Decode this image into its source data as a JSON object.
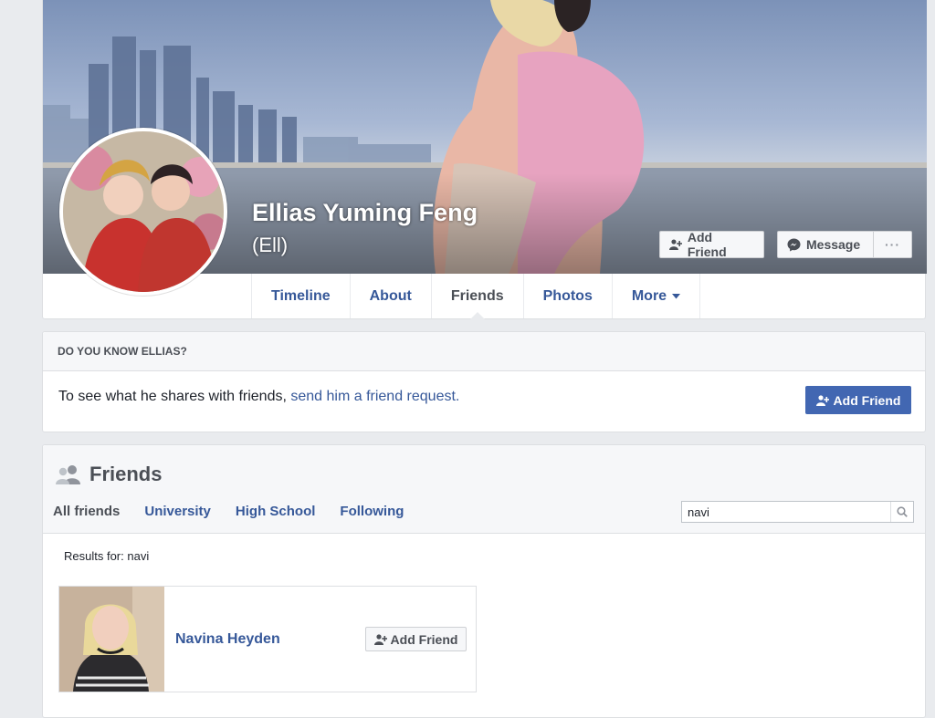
{
  "profile": {
    "name": "Ellias Yuming Feng",
    "alternate_name": "(Ell)",
    "add_friend_label": "Add Friend",
    "message_label": "Message",
    "more_dots": "···"
  },
  "tabs": [
    {
      "label": "Timeline"
    },
    {
      "label": "About"
    },
    {
      "label": "Friends",
      "active": true
    },
    {
      "label": "Photos"
    },
    {
      "label": "More"
    }
  ],
  "know_card": {
    "heading": "DO YOU KNOW ELLIAS?",
    "text": "To see what he shares with friends,",
    "link": "send him a friend request.",
    "button": "Add Friend"
  },
  "friends": {
    "title": "Friends",
    "subtabs": [
      {
        "label": "All friends",
        "active": true
      },
      {
        "label": "University"
      },
      {
        "label": "High School"
      },
      {
        "label": "Following"
      }
    ],
    "search_value": "navi",
    "results_label": "Results for: navi",
    "results": [
      {
        "name": "Navina Heyden",
        "button": "Add Friend"
      }
    ]
  },
  "colors": {
    "link_blue": "#365899",
    "button_blue": "#4267b2",
    "page_bg": "#e9ebee",
    "muted_text": "#4b4f56"
  },
  "icons": [
    "add-friend-icon",
    "messenger-icon",
    "dropdown-caret-icon",
    "friends-icon",
    "search-icon"
  ]
}
